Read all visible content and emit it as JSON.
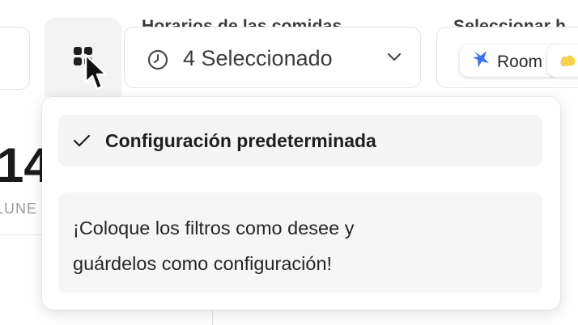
{
  "filters": {
    "meal_times": {
      "label": "Horarios de las comidas",
      "value": "4 Seleccionado",
      "icon": "clock-icon"
    },
    "rooms": {
      "label": "Seleccionar h",
      "chips": [
        {
          "label": "Room",
          "icon": "blue-star-icon",
          "color": "#3b6ff5"
        },
        {
          "label": "",
          "icon": "yellow-shape-icon",
          "color": "#f5d24a"
        }
      ]
    }
  },
  "background": {
    "date_number": "14",
    "day_label": "LUNE"
  },
  "popover": {
    "option_label": "Configuración predeterminada",
    "hint_lines": [
      "¡Coloque los filtros como desee y",
      "guárdelos como configuración!"
    ]
  },
  "colors": {
    "accent_blue": "#3b6ff5",
    "chip_yellow": "#f5d24a",
    "panel_bg": "#f5f5f5",
    "border": "#e3e3e3"
  }
}
